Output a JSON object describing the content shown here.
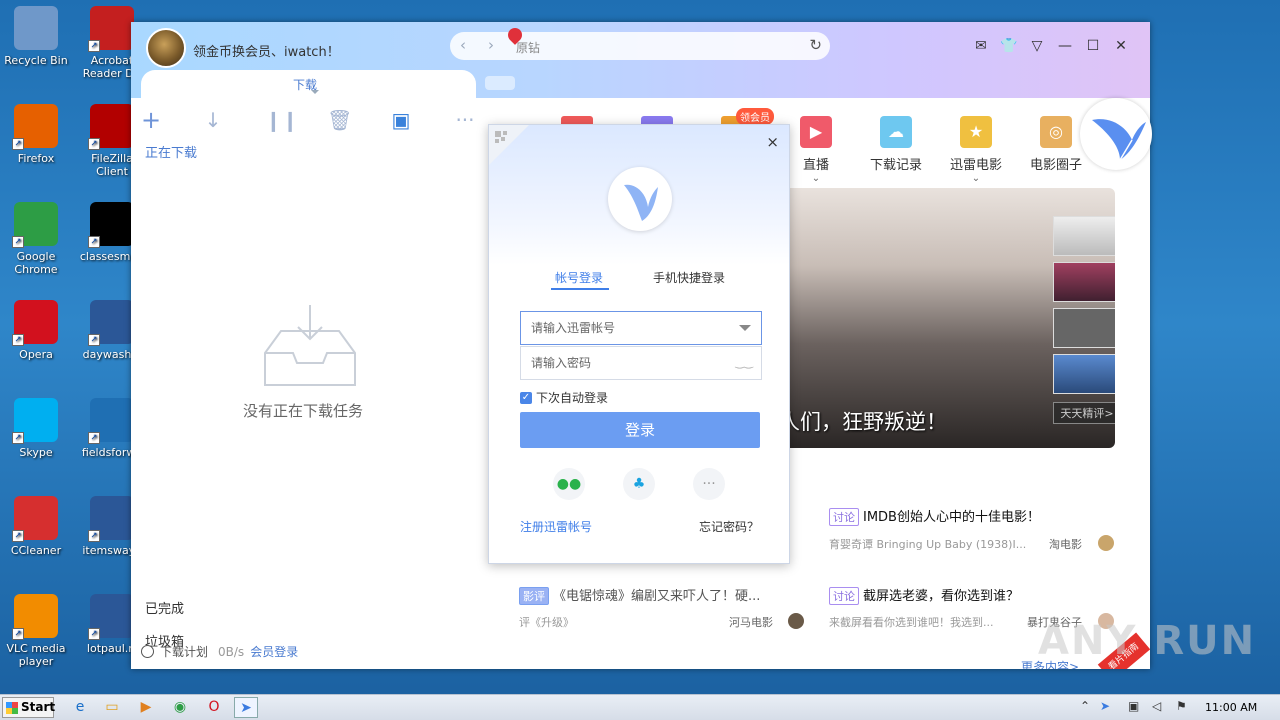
{
  "desktop": {
    "icons": [
      {
        "label": "Recycle Bin",
        "color": "#6f98c9"
      },
      {
        "label": "Acrobat Reader DC",
        "color": "#c41f1f"
      },
      {
        "label": "Firefox",
        "color": "#e66000"
      },
      {
        "label": "FileZilla Client",
        "color": "#b20000"
      },
      {
        "label": "Google Chrome",
        "color": "#2d9d45"
      },
      {
        "label": "classesmen",
        "color": "#000000"
      },
      {
        "label": "Opera",
        "color": "#d2111e"
      },
      {
        "label": "daywashin",
        "color": "#2b5797"
      },
      {
        "label": "Skype",
        "color": "#00aff0"
      },
      {
        "label": "fieldsforwa",
        "color": "#1f6fb3"
      },
      {
        "label": "CCleaner",
        "color": "#d62f2f"
      },
      {
        "label": "itemsway.r",
        "color": "#2b5797"
      },
      {
        "label": "VLC media player",
        "color": "#f28c00"
      },
      {
        "label": "lotpaul.rt",
        "color": "#2b5797"
      }
    ]
  },
  "app": {
    "promo_text": "领金币换会员、iwatch！",
    "url_placeholder": "原钻",
    "download_tab": "下载",
    "active_category": "正在下载",
    "empty_text": "没有正在下载任务",
    "completed": "已完成",
    "trash": "垃圾箱",
    "footer": {
      "plan": "下载计划",
      "speed": "0B/s",
      "login": "会员登录"
    },
    "features": [
      {
        "label": "直播",
        "color": "#f05a6a",
        "glyph": "▶",
        "chevron": true
      },
      {
        "label": "下载记录",
        "color": "#6ec8f0",
        "glyph": "☁",
        "chevron": false
      },
      {
        "label": "迅雷电影",
        "color": "#f0c040",
        "glyph": "★",
        "chevron": true
      },
      {
        "label": "电影圈子",
        "color": "#e8b060",
        "glyph": "◎",
        "chevron": false
      }
    ],
    "vip_tag": "领会员",
    "banner_caption": "人们，狂野叛逆！",
    "banner_more": "天天精评>",
    "news": [
      {
        "tag": "讨论",
        "title": "IMDB创始人心中的十佳电影！",
        "sub": "育婴奇谭 Bringing Up Baby (1938)I...",
        "author": "淘电影"
      },
      {
        "tag": "影评",
        "title": "《电锯惊魂》编剧又来吓人了！硬...",
        "sub": "评《升级》",
        "author": "河马电影"
      },
      {
        "tag": "讨论",
        "title": "截屏选老婆，看你选到谁？",
        "sub": "来截屏看看你选到谁吧！我选到...",
        "author": "暴打鬼谷子"
      }
    ],
    "more_content": "更多内容>",
    "corner_tag": "看片指南"
  },
  "login": {
    "tab_account": "帐号登录",
    "tab_phone": "手机快捷登录",
    "account_placeholder": "请输入迅雷帐号",
    "password_placeholder": "请输入密码",
    "auto_login": "下次自动登录",
    "login_button": "登录",
    "register": "注册迅雷帐号",
    "forgot": "忘记密码？",
    "close": "×"
  },
  "taskbar": {
    "start": "Start",
    "time": "11:00 AM"
  },
  "watermark": "ANY RUN"
}
